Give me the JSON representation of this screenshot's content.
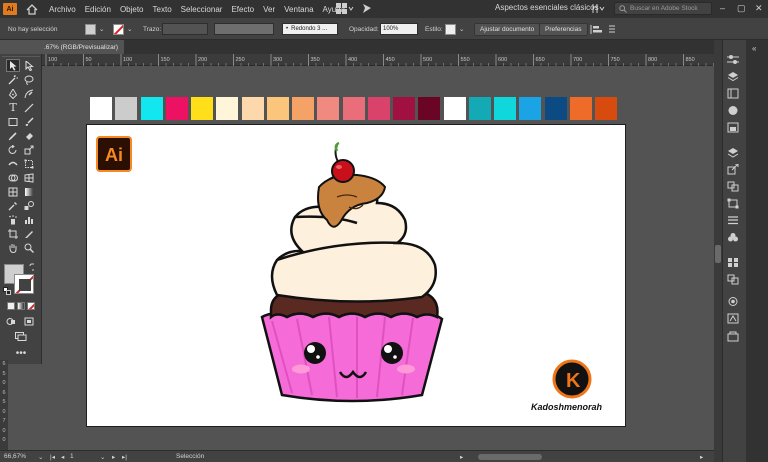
{
  "menubar": {
    "items": [
      "Archivo",
      "Edición",
      "Objeto",
      "Texto",
      "Seleccionar",
      "Efecto",
      "Ver",
      "Ventana",
      "Ayuda"
    ],
    "workspace": "Aspectos esenciales clásicos",
    "search_placeholder": "Buscar en Adobe Stock",
    "app_logo_text": "Ai"
  },
  "controlbar": {
    "selection_status": "No hay selección",
    "stroke_label": "Trazo:",
    "brush_label": "Redondo 3 ...",
    "opacity_label": "Opacidad:",
    "opacity_value": "100%",
    "style_label": "Estilo:",
    "adjust_button": "Ajustar documento",
    "prefs_button": "Preferencias"
  },
  "document_tab": {
    "label": ".67% (RGB/Previsualizar)"
  },
  "ruler": {
    "ticks": [
      "100",
      "50",
      "100",
      "150",
      "200",
      "250",
      "300",
      "350",
      "400",
      "450",
      "500",
      "550",
      "600",
      "650",
      "700",
      "750",
      "800",
      "850"
    ]
  },
  "vruler": {
    "ticks": [
      "6",
      "5",
      "0",
      "6",
      "5",
      "0",
      "7",
      "0",
      "0"
    ]
  },
  "swatches": {
    "colors": [
      "#ffffff",
      "#cccccc",
      "#12e6ef",
      "#ec1163",
      "#ffdf19",
      "#fff5d9",
      "#fdd8ac",
      "#fbc57b",
      "#f4a266",
      "#f08a80",
      "#ea6d7a",
      "#d8426b",
      "#a01040",
      "#6b0525",
      "#ffffff",
      "#13aab5",
      "#0fd7dc",
      "#1aa4e6",
      "#0b4a82",
      "#ee6b2a",
      "#d84b0e"
    ]
  },
  "artwork": {
    "ai_logo_text": "Ai",
    "brand_text": "Kadoshmenorah",
    "brand_logo_letter": "K"
  },
  "statusbar": {
    "zoom": "66,67%",
    "artboard_number": "1",
    "tool_name": "Selección"
  }
}
